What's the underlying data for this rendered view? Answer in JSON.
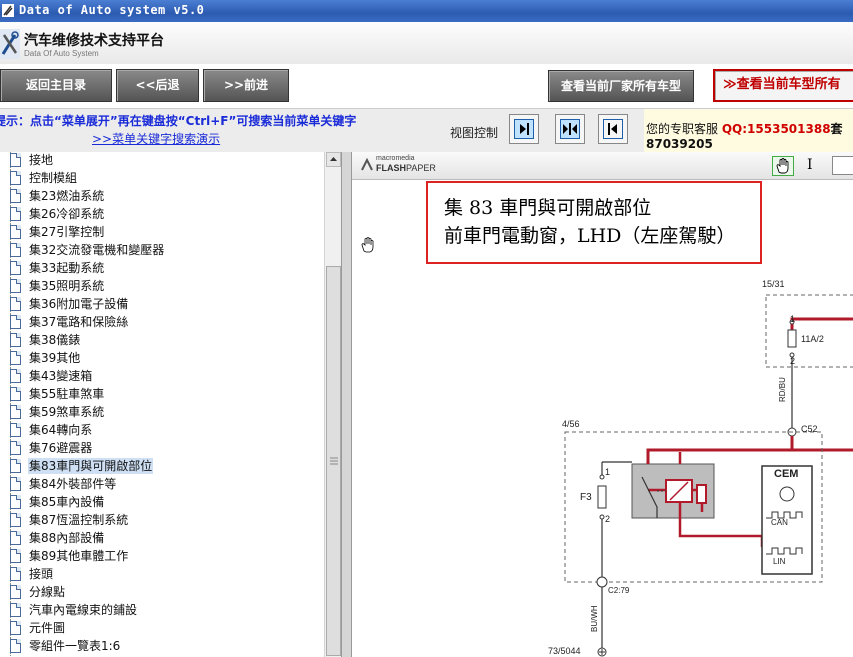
{
  "window": {
    "title": "Data of Auto system v5.0"
  },
  "header": {
    "title": "汽车维修技术支持平台",
    "subtitle": "Data Of Auto System"
  },
  "toolbar": {
    "home": "返回主目录",
    "back": "<<后退",
    "forward": ">>前进",
    "all_models": "查看当前厂家所有车型",
    "current_model": "≫查看当前车型所有"
  },
  "hint": {
    "text": "提示：点击“菜单展开”再在键盘按“Ctrl+F”可搜索当前菜单关键字",
    "link": ">>菜单关键字搜索演示",
    "view_label": "视图控制"
  },
  "service": {
    "label": "您的专职客服",
    "qq": "QQ:1553501388",
    "qq_tail": "套",
    "extra": "87039205"
  },
  "tree": {
    "selected_index": 17,
    "items": [
      "接地",
      "控制模組",
      "集23燃油系統",
      "集26冷卻系統",
      "集27引擎控制",
      "集32交流發電機和變壓器",
      "集33起動系統",
      "集35照明系統",
      "集36附加電子設備",
      "集37電路和保險絲",
      "集38儀錶",
      "集39其他",
      "集43變速箱",
      "集55駐車煞車",
      "集59煞車系統",
      "集64轉向系",
      "集76避震器",
      "集83車門與可開啟部位",
      "集84外裝部件等",
      "集85車內設備",
      "集87恆溫控制系統",
      "集88內部設備",
      "集89其他車體工作",
      "接頭",
      "分線點",
      "汽車內電線束的鋪設",
      "元件圖",
      "零組件一覽表1:6"
    ]
  },
  "viewer": {
    "brand_small": "macromedia",
    "brand_flash": "FLASH",
    "brand_paper": "PAPER",
    "cursor_label": "I",
    "doc_title_1": "集 83 車門與可開啟部位",
    "doc_title_2": "前車門電動窗，LHD（左座駕駛）",
    "diagram": {
      "label_1531": "15/31",
      "fuse_11a": "11A/2",
      "wire_rdbu": "RD/BU",
      "conn_c52": "C52",
      "label_456": "4/56",
      "fuse_f3": "F3",
      "cem": "CEM",
      "can": "CAN",
      "lin": "LIN",
      "conn_c279": "C2:79",
      "wire_buwh": "BU/WH",
      "label_735044": "73/5044",
      "pin1": "1",
      "pin2": "2"
    }
  },
  "colors": {
    "title_bar": "#2c5bb0",
    "hint_text": "#1a2bd8",
    "accent_red": "#c00000",
    "wire_red": "#b01a2a"
  }
}
